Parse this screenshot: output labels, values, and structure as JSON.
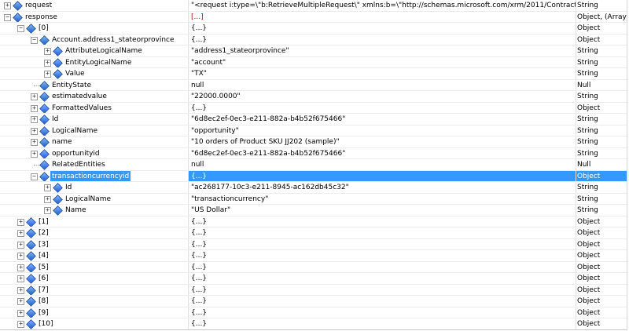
{
  "rows": [
    {
      "name": "request",
      "value": "\"<request i:type=\\\"b:RetrieveMultipleRequest\\\" xmlns:b=\\\"http://schemas.microsoft.com/xrm/2011/Contract...",
      "type": "String",
      "depth": 0,
      "exp": "+"
    },
    {
      "name": "response",
      "value": "[...]",
      "type": "Object, (Array)",
      "depth": 0,
      "exp": "-"
    },
    {
      "name": "[0]",
      "value": "{...}",
      "type": "Object",
      "depth": 1,
      "exp": "-"
    },
    {
      "name": "Account.address1_stateorprovince",
      "value": "{...}",
      "type": "Object",
      "depth": 2,
      "exp": "-"
    },
    {
      "name": "AttributeLogicalName",
      "value": "\"address1_stateorprovince\"",
      "type": "String",
      "depth": 3,
      "exp": "+"
    },
    {
      "name": "EntityLogicalName",
      "value": "\"account\"",
      "type": "String",
      "depth": 3,
      "exp": "+"
    },
    {
      "name": "Value",
      "value": "\"TX\"",
      "type": "String",
      "depth": 3,
      "exp": "+"
    },
    {
      "name": "EntityState",
      "value": "null",
      "type": "Null",
      "depth": 2,
      "exp": ""
    },
    {
      "name": "estimatedvalue",
      "value": "\"22000.0000\"",
      "type": "String",
      "depth": 2,
      "exp": "+"
    },
    {
      "name": "FormattedValues",
      "value": "{...}",
      "type": "Object",
      "depth": 2,
      "exp": "+"
    },
    {
      "name": "Id",
      "value": "\"6d8ec2ef-0ec3-e211-882a-b4b52f675466\"",
      "type": "String",
      "depth": 2,
      "exp": "+"
    },
    {
      "name": "LogicalName",
      "value": "\"opportunity\"",
      "type": "String",
      "depth": 2,
      "exp": "+"
    },
    {
      "name": "name",
      "value": "\"10 orders of Product SKU JJ202 (sample)\"",
      "type": "String",
      "depth": 2,
      "exp": "+"
    },
    {
      "name": "opportunityid",
      "value": "\"6d8ec2ef-0ec3-e211-882a-b4b52f675466\"",
      "type": "String",
      "depth": 2,
      "exp": "+"
    },
    {
      "name": "RelatedEntities",
      "value": "null",
      "type": "Null",
      "depth": 2,
      "exp": ""
    },
    {
      "name": "transactioncurrencyid",
      "value": "{...}",
      "type": "Object",
      "depth": 2,
      "exp": "-",
      "selected": true
    },
    {
      "name": "Id",
      "value": "\"ac268177-10c3-e211-8945-ac162db45c32\"",
      "type": "String",
      "depth": 3,
      "exp": "+"
    },
    {
      "name": "LogicalName",
      "value": "\"transactioncurrency\"",
      "type": "String",
      "depth": 3,
      "exp": "+"
    },
    {
      "name": "Name",
      "value": "\"US Dollar\"",
      "type": "String",
      "depth": 3,
      "exp": "+"
    },
    {
      "name": "[1]",
      "value": "{...}",
      "type": "Object",
      "depth": 1,
      "exp": "+"
    },
    {
      "name": "[2]",
      "value": "{...}",
      "type": "Object",
      "depth": 1,
      "exp": "+"
    },
    {
      "name": "[3]",
      "value": "{...}",
      "type": "Object",
      "depth": 1,
      "exp": "+"
    },
    {
      "name": "[4]",
      "value": "{...}",
      "type": "Object",
      "depth": 1,
      "exp": "+"
    },
    {
      "name": "[5]",
      "value": "{...}",
      "type": "Object",
      "depth": 1,
      "exp": "+"
    },
    {
      "name": "[6]",
      "value": "{...}",
      "type": "Object",
      "depth": 1,
      "exp": "+"
    },
    {
      "name": "[7]",
      "value": "{...}",
      "type": "Object",
      "depth": 1,
      "exp": "+"
    },
    {
      "name": "[8]",
      "value": "{...}",
      "type": "Object",
      "depth": 1,
      "exp": "+"
    },
    {
      "name": "[9]",
      "value": "{...}",
      "type": "Object",
      "depth": 1,
      "exp": "+"
    },
    {
      "name": "[10]",
      "value": "{...}",
      "type": "Object",
      "depth": 1,
      "exp": "+"
    }
  ]
}
